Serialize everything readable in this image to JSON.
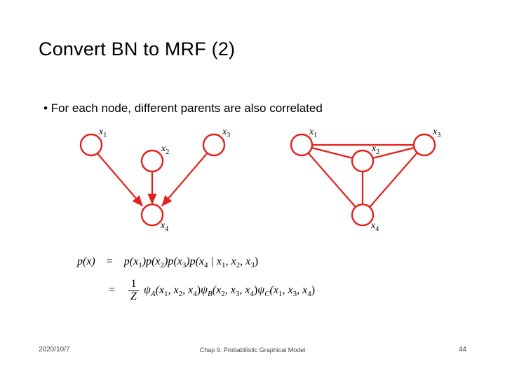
{
  "title": "Convert BN to MRF (2)",
  "bullet": "• For each node, different parents are also correlated",
  "labels": {
    "x1": "x",
    "x1s": "1",
    "x2": "x",
    "x2s": "2",
    "x3": "x",
    "x3s": "3",
    "x4": "x",
    "x4s": "4"
  },
  "footer": {
    "left": "2020/10/7",
    "mid": "Chap 9. Probabilistic Graphical Model",
    "right": "44"
  },
  "equation": {
    "lhs": "p(x)",
    "eq": "=",
    "rhs1_a": "p(x",
    "rhs1_b": ")p(x",
    "rhs1_c": ")p(x",
    "rhs1_d": ")p(x",
    "rhs1_bar": " | x",
    "rhs1_comma": ", x",
    "rhs1_end": ")",
    "frac_num": "1",
    "frac_den": "Z",
    "psiA": "ψ",
    "psiAs": "A",
    "psiB": "ψ",
    "psiBs": "B",
    "psiC": "ψ",
    "psiCs": "C",
    "arg_open": "(x",
    "arg_close": ")",
    "s1": "1",
    "s2": "2",
    "s3": "3",
    "s4": "4"
  }
}
